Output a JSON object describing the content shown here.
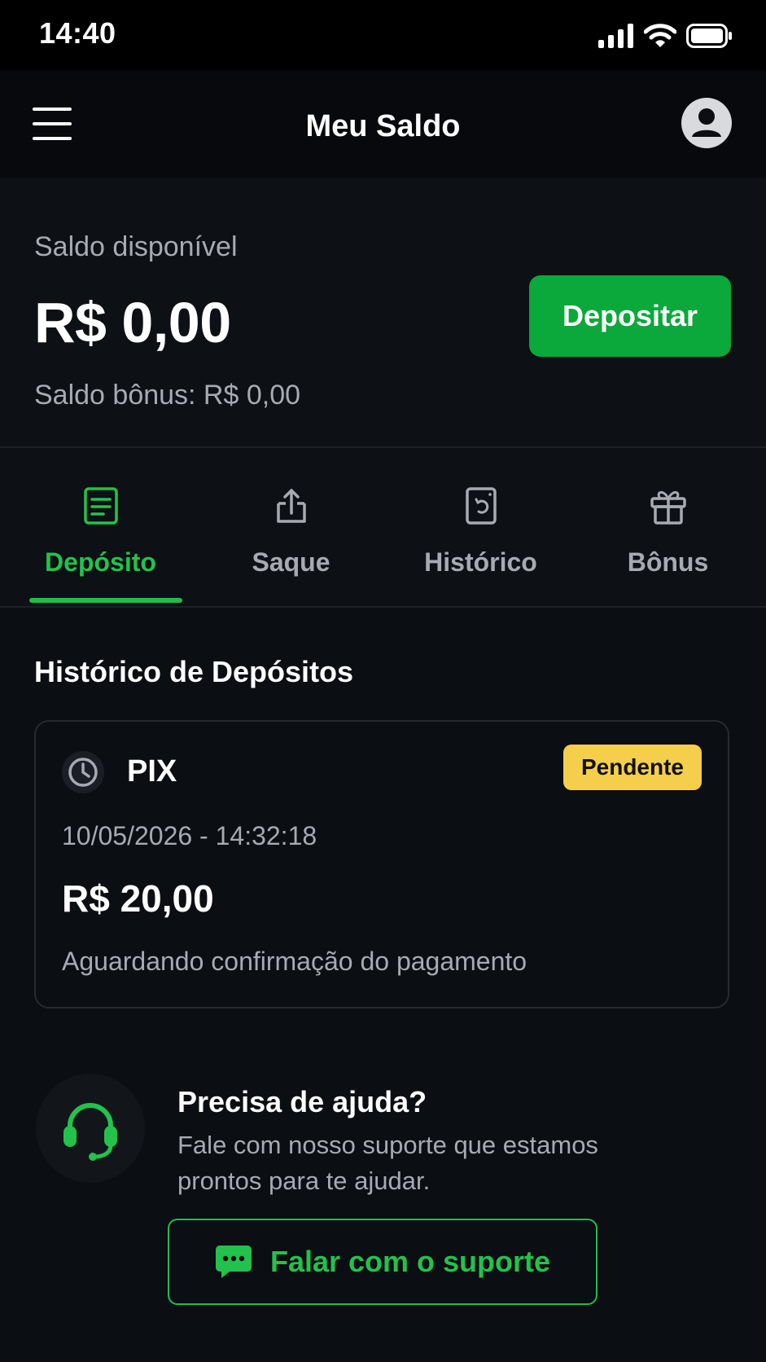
{
  "status_bar": {
    "time": "14:40"
  },
  "header": {
    "title": "Meu Saldo"
  },
  "balance": {
    "label": "Saldo disponível",
    "value": "R$ 0,00",
    "bonus": "Saldo bônus: R$ 0,00",
    "deposit_button": "Depositar"
  },
  "tabs": [
    {
      "label": "Depósito",
      "icon": "receipt-icon",
      "active": true
    },
    {
      "label": "Saque",
      "icon": "upload-icon",
      "active": false
    },
    {
      "label": "Histórico",
      "icon": "history-doc-icon",
      "active": false
    },
    {
      "label": "Bônus",
      "icon": "gift-icon",
      "active": false
    }
  ],
  "history": {
    "title": "Histórico de Depósitos",
    "items": [
      {
        "method": "PIX",
        "status_badge": "Pendente",
        "datetime": "10/05/2026 - 14:32:18",
        "amount": "R$ 20,00",
        "status_text": "Aguardando confirmação do pagamento"
      }
    ]
  },
  "help": {
    "title": "Precisa de ajuda?",
    "text": "Fale com nosso suporte que estamos prontos para te ajudar.",
    "button": "Falar com o suporte"
  },
  "colors": {
    "accent_green": "#22c24c",
    "button_green": "#0ba83b",
    "badge_yellow": "#f5cf4b",
    "background": "#0b0e12"
  }
}
